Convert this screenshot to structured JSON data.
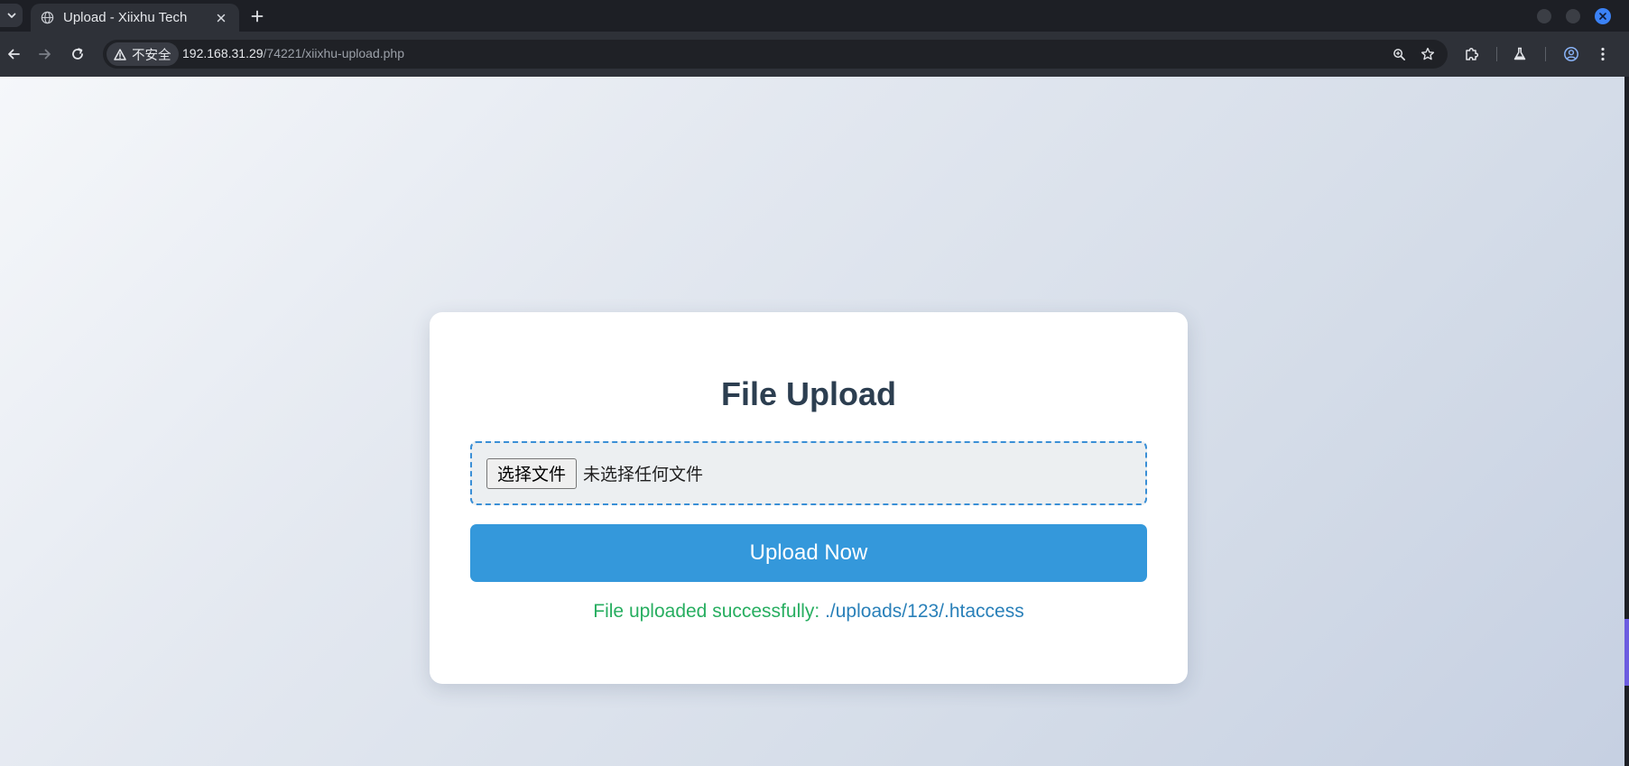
{
  "browser": {
    "tab": {
      "title": "Upload - Xiixhu Tech"
    },
    "address": {
      "security_label": "不安全",
      "url_host": "192.168.31.29",
      "url_path": "/74221/xiixhu-upload.php"
    },
    "icons": {
      "tab_search": "chevron-down-icon",
      "favicon": "globe-icon",
      "tab_close": "close-icon",
      "new_tab": "plus-icon",
      "back": "arrow-left-icon",
      "forward": "arrow-right-icon",
      "reload": "reload-icon",
      "security": "warning-icon",
      "zoom": "zoom-icon",
      "bookmark": "star-icon",
      "extensions": "puzzle-icon",
      "labs": "flask-icon",
      "profile": "profile-icon",
      "menu": "kebab-menu-icon"
    },
    "colors": {
      "frame": "#1d1f25",
      "toolbar": "#2e3138",
      "close_accent": "#3b82f6"
    }
  },
  "page": {
    "title": "File Upload",
    "file_input": {
      "button_label": "选择文件",
      "status_text": "未选择任何文件"
    },
    "upload_button_label": "Upload Now",
    "message": {
      "text": "File uploaded successfully: ",
      "path": "./uploads/123/.htaccess"
    },
    "colors": {
      "title": "#2c3e50",
      "accent": "#3498db",
      "success": "#27ae60",
      "path_link": "#2980b9"
    }
  }
}
